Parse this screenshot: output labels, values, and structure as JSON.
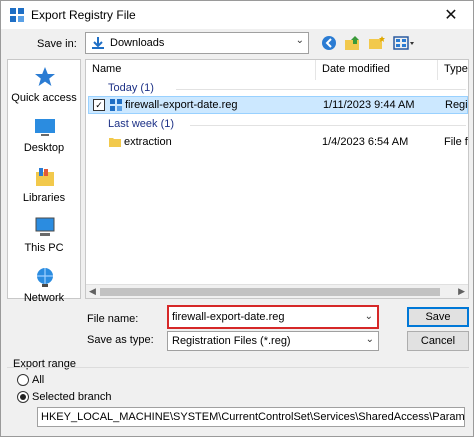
{
  "window": {
    "title": "Export Registry File",
    "close_glyph": "✕"
  },
  "save_in": {
    "label": "Save in:",
    "value": "Downloads"
  },
  "places": [
    {
      "label": "Quick access",
      "icon": "star-icon"
    },
    {
      "label": "Desktop",
      "icon": "desktop-icon"
    },
    {
      "label": "Libraries",
      "icon": "libraries-icon"
    },
    {
      "label": "This PC",
      "icon": "computer-icon"
    },
    {
      "label": "Network",
      "icon": "network-icon"
    }
  ],
  "columns": {
    "name": "Name",
    "date": "Date modified",
    "type": "Type"
  },
  "groups": [
    {
      "label": "Today (1)",
      "items": [
        {
          "name": "firewall-export-date.reg",
          "date": "1/11/2023 9:44 AM",
          "type": "Regis",
          "selected": true,
          "kind": "reg-file-icon"
        }
      ]
    },
    {
      "label": "Last week (1)",
      "items": [
        {
          "name": "extraction",
          "date": "1/4/2023 6:54 AM",
          "type": "File fo",
          "selected": false,
          "kind": "folder-icon"
        }
      ]
    }
  ],
  "file_name": {
    "label": "File name:",
    "value": "firewall-export-date.reg"
  },
  "save_as_type": {
    "label": "Save as type:",
    "value": "Registration Files (*.reg)"
  },
  "buttons": {
    "save": "Save",
    "cancel": "Cancel"
  },
  "export_range": {
    "title": "Export range",
    "all_label": "All",
    "selected_label": "Selected branch",
    "selected": "branch",
    "branch_path": "HKEY_LOCAL_MACHINE\\SYSTEM\\CurrentControlSet\\Services\\SharedAccess\\Parameters\\FirewallP"
  },
  "colors": {
    "accent": "#0078d7",
    "highlight": "#d62828",
    "selection": "#cce8ff"
  }
}
